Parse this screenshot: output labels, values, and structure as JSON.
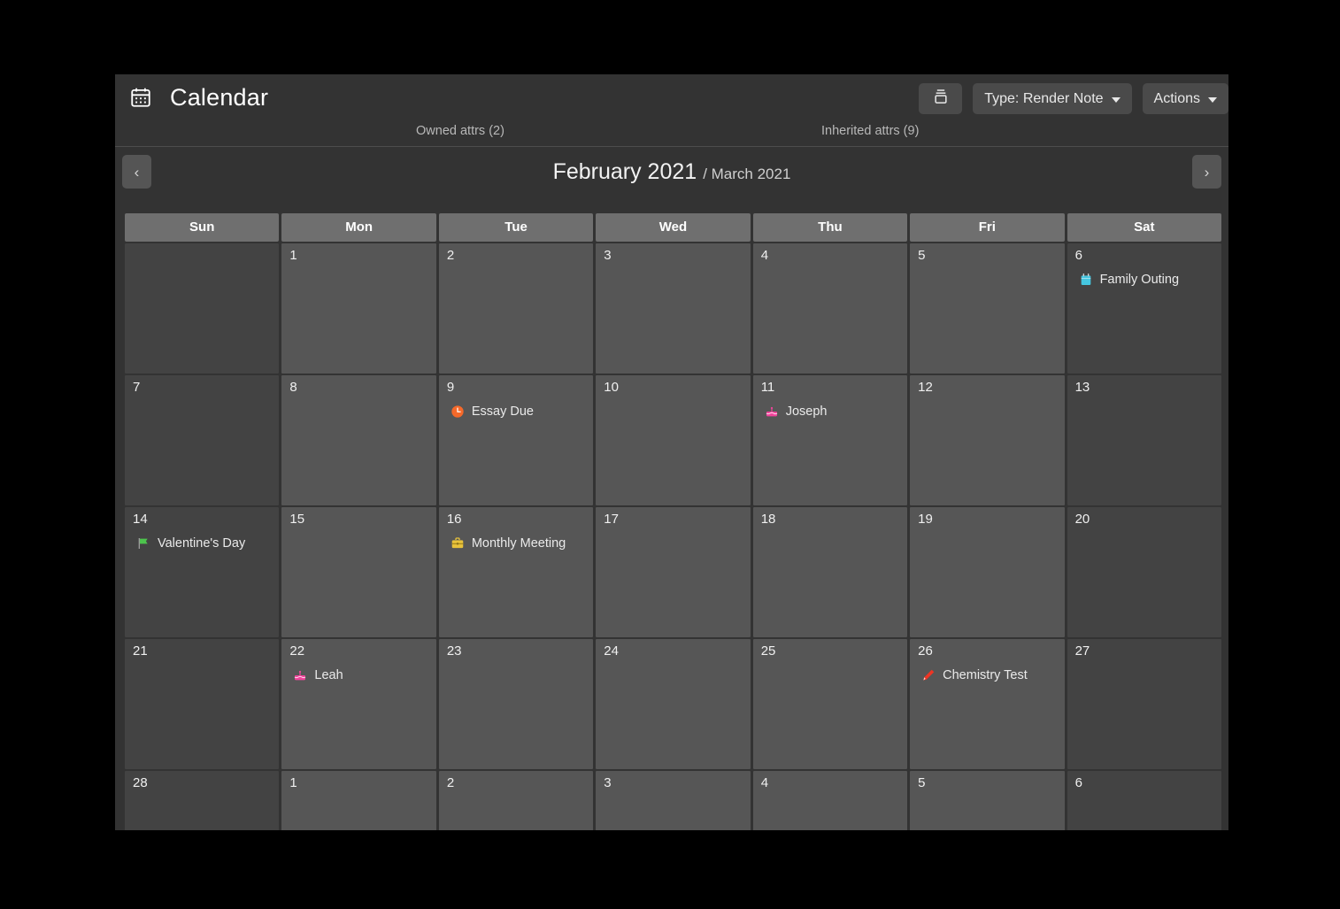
{
  "header": {
    "icon": "calendar-icon",
    "title": "Calendar",
    "archive_button_icon": "archive-stack-icon",
    "type_button_label": "Type: Render Note",
    "actions_button_label": "Actions",
    "caret_icon": "chevron-down-icon"
  },
  "attrs": {
    "owned": "Owned attrs (2)",
    "inherited": "Inherited attrs (9)"
  },
  "nav": {
    "prev_icon": "chevron-left-icon",
    "prev_label": "‹",
    "next_icon": "chevron-right-icon",
    "next_label": "›",
    "month_primary": "February 2021",
    "month_secondary": "/ March 2021"
  },
  "weekdays": [
    "Sun",
    "Mon",
    "Tue",
    "Wed",
    "Thu",
    "Fri",
    "Sat"
  ],
  "colors": {
    "panel_bg": "#333333",
    "cell_weekday": "#565656",
    "cell_weekend": "#434343",
    "dow_header": "#6f6f6f",
    "event_calendar": "#45c6e0",
    "event_clock": "#f5692a",
    "event_cake": "#f0449b",
    "event_flag": "#4dc44d",
    "event_briefcase": "#e8c23b",
    "event_pencil": "#ee3524"
  },
  "days": [
    {
      "number": "",
      "weekend": true,
      "blank": true,
      "events": []
    },
    {
      "number": "1",
      "weekend": false,
      "blank": false,
      "events": []
    },
    {
      "number": "2",
      "weekend": false,
      "blank": false,
      "events": []
    },
    {
      "number": "3",
      "weekend": false,
      "blank": false,
      "events": []
    },
    {
      "number": "4",
      "weekend": false,
      "blank": false,
      "events": []
    },
    {
      "number": "5",
      "weekend": false,
      "blank": false,
      "events": []
    },
    {
      "number": "6",
      "weekend": true,
      "blank": false,
      "events": [
        {
          "icon": "calendar-event-icon",
          "label": "Family Outing"
        }
      ]
    },
    {
      "number": "7",
      "weekend": true,
      "blank": false,
      "events": []
    },
    {
      "number": "8",
      "weekend": false,
      "blank": false,
      "events": []
    },
    {
      "number": "9",
      "weekend": false,
      "blank": false,
      "events": [
        {
          "icon": "clock-icon",
          "label": "Essay Due"
        }
      ]
    },
    {
      "number": "10",
      "weekend": false,
      "blank": false,
      "events": []
    },
    {
      "number": "11",
      "weekend": false,
      "blank": false,
      "events": [
        {
          "icon": "birthday-cake-icon",
          "label": "Joseph"
        }
      ]
    },
    {
      "number": "12",
      "weekend": false,
      "blank": false,
      "events": []
    },
    {
      "number": "13",
      "weekend": true,
      "blank": false,
      "events": []
    },
    {
      "number": "14",
      "weekend": true,
      "blank": false,
      "events": [
        {
          "icon": "flag-icon",
          "label": "Valentine's Day"
        }
      ]
    },
    {
      "number": "15",
      "weekend": false,
      "blank": false,
      "events": []
    },
    {
      "number": "16",
      "weekend": false,
      "blank": false,
      "events": [
        {
          "icon": "briefcase-icon",
          "label": "Monthly Meeting"
        }
      ]
    },
    {
      "number": "17",
      "weekend": false,
      "blank": false,
      "events": []
    },
    {
      "number": "18",
      "weekend": false,
      "blank": false,
      "events": []
    },
    {
      "number": "19",
      "weekend": false,
      "blank": false,
      "events": []
    },
    {
      "number": "20",
      "weekend": true,
      "blank": false,
      "events": []
    },
    {
      "number": "21",
      "weekend": true,
      "blank": false,
      "events": []
    },
    {
      "number": "22",
      "weekend": false,
      "blank": false,
      "events": [
        {
          "icon": "birthday-cake-icon",
          "label": "Leah"
        }
      ]
    },
    {
      "number": "23",
      "weekend": false,
      "blank": false,
      "events": []
    },
    {
      "number": "24",
      "weekend": false,
      "blank": false,
      "events": []
    },
    {
      "number": "25",
      "weekend": false,
      "blank": false,
      "events": []
    },
    {
      "number": "26",
      "weekend": false,
      "blank": false,
      "events": [
        {
          "icon": "pencil-icon",
          "label": "Chemistry Test"
        }
      ]
    },
    {
      "number": "27",
      "weekend": true,
      "blank": false,
      "events": []
    },
    {
      "number": "28",
      "weekend": true,
      "blank": false,
      "events": []
    },
    {
      "number": "1",
      "weekend": false,
      "blank": false,
      "events": []
    },
    {
      "number": "2",
      "weekend": false,
      "blank": false,
      "events": []
    },
    {
      "number": "3",
      "weekend": false,
      "blank": false,
      "events": []
    },
    {
      "number": "4",
      "weekend": false,
      "blank": false,
      "events": []
    },
    {
      "number": "5",
      "weekend": false,
      "blank": false,
      "events": []
    },
    {
      "number": "6",
      "weekend": true,
      "blank": false,
      "events": []
    }
  ]
}
